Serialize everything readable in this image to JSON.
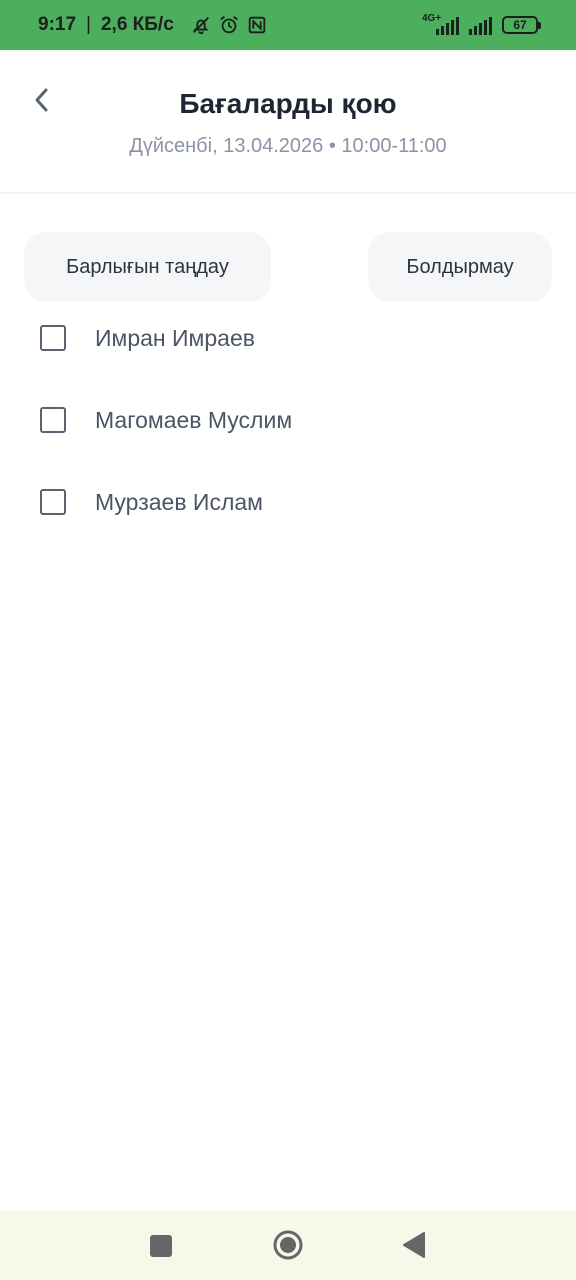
{
  "status_bar": {
    "time": "9:17",
    "separator": "|",
    "net_speed": "2,6 КБ/с",
    "net_type": "4G+",
    "battery": "67",
    "icons": [
      "mute-icon",
      "alarm-icon",
      "nfc-icon",
      "signal-icon",
      "signal-icon-2",
      "battery-icon"
    ]
  },
  "header": {
    "title": "Бағаларды қою",
    "subtitle": "Дүйсенбі, 13.04.2026 • 10:00-11:00",
    "back_icon": "chevron-left-icon"
  },
  "actions": {
    "select_all": "Барлығын таңдау",
    "cancel": "Болдырмау"
  },
  "students": [
    {
      "name": "Имран Имраев",
      "checked": false
    },
    {
      "name": "Магомаев Муслим",
      "checked": false
    },
    {
      "name": "Мурзаев Ислам",
      "checked": false
    }
  ],
  "colors": {
    "status_bar": "#4caf5e",
    "nav_bar": "#f6f9ea",
    "title": "#1f2633",
    "subtitle": "#8a94a4"
  }
}
